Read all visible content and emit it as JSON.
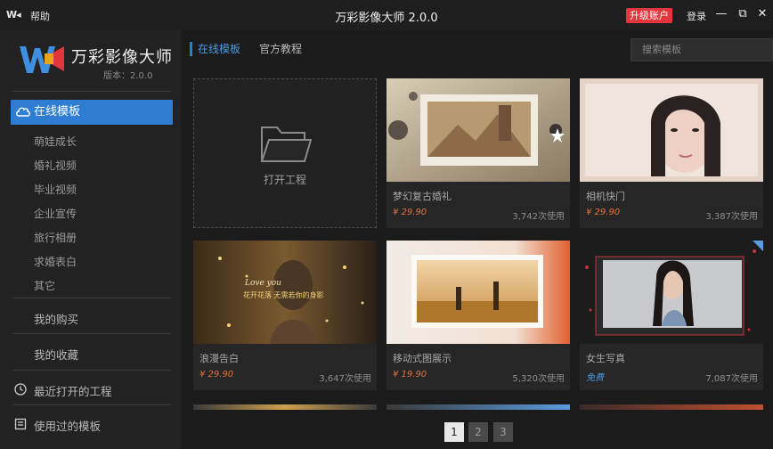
{
  "titlebar": {
    "logo": "W◂",
    "help": "帮助",
    "title": "万彩影像大师 2.0.0",
    "upgrade": "升级账户",
    "login": "登录",
    "minimize": "—",
    "restore": "⧉",
    "close": "✕"
  },
  "brand": {
    "name": "万彩影像大师",
    "version": "版本：2.0.0"
  },
  "sidebar": {
    "active": "在线模板",
    "sub_items": [
      "萌娃成长",
      "婚礼视频",
      "毕业视频",
      "企业宣传",
      "旅行相册",
      "求婚表白",
      "其它"
    ],
    "purchases": "我的购买",
    "favorites": "我的收藏",
    "recent": "最近打开的工程",
    "used": "使用过的模板"
  },
  "tabs": {
    "active": "在线模板",
    "other": "官方教程"
  },
  "search": {
    "placeholder": "搜索模板"
  },
  "open_project": "打开工程",
  "cards": [
    {
      "title": "梦幻复古婚礼",
      "price": "¥ 29.90",
      "uses": "3,742次使用"
    },
    {
      "title": "相机快门",
      "price": "¥ 29.90",
      "uses": "3,387次使用"
    },
    {
      "title": "浪漫告白",
      "price": "¥ 29.90",
      "uses": "3,647次使用",
      "overlay_title": "Love you",
      "overlay_text": "花开花落 无需若你的身影"
    },
    {
      "title": "移动式图展示",
      "price": "¥ 19.90",
      "uses": "5,320次使用"
    },
    {
      "title": "女生写真",
      "price": "免费",
      "uses": "7,087次使用"
    }
  ],
  "pagination": [
    "1",
    "2",
    "3"
  ],
  "colors": {
    "accent": "#2f7dd2",
    "price": "#e8733a",
    "upgrade": "#e2353e"
  }
}
